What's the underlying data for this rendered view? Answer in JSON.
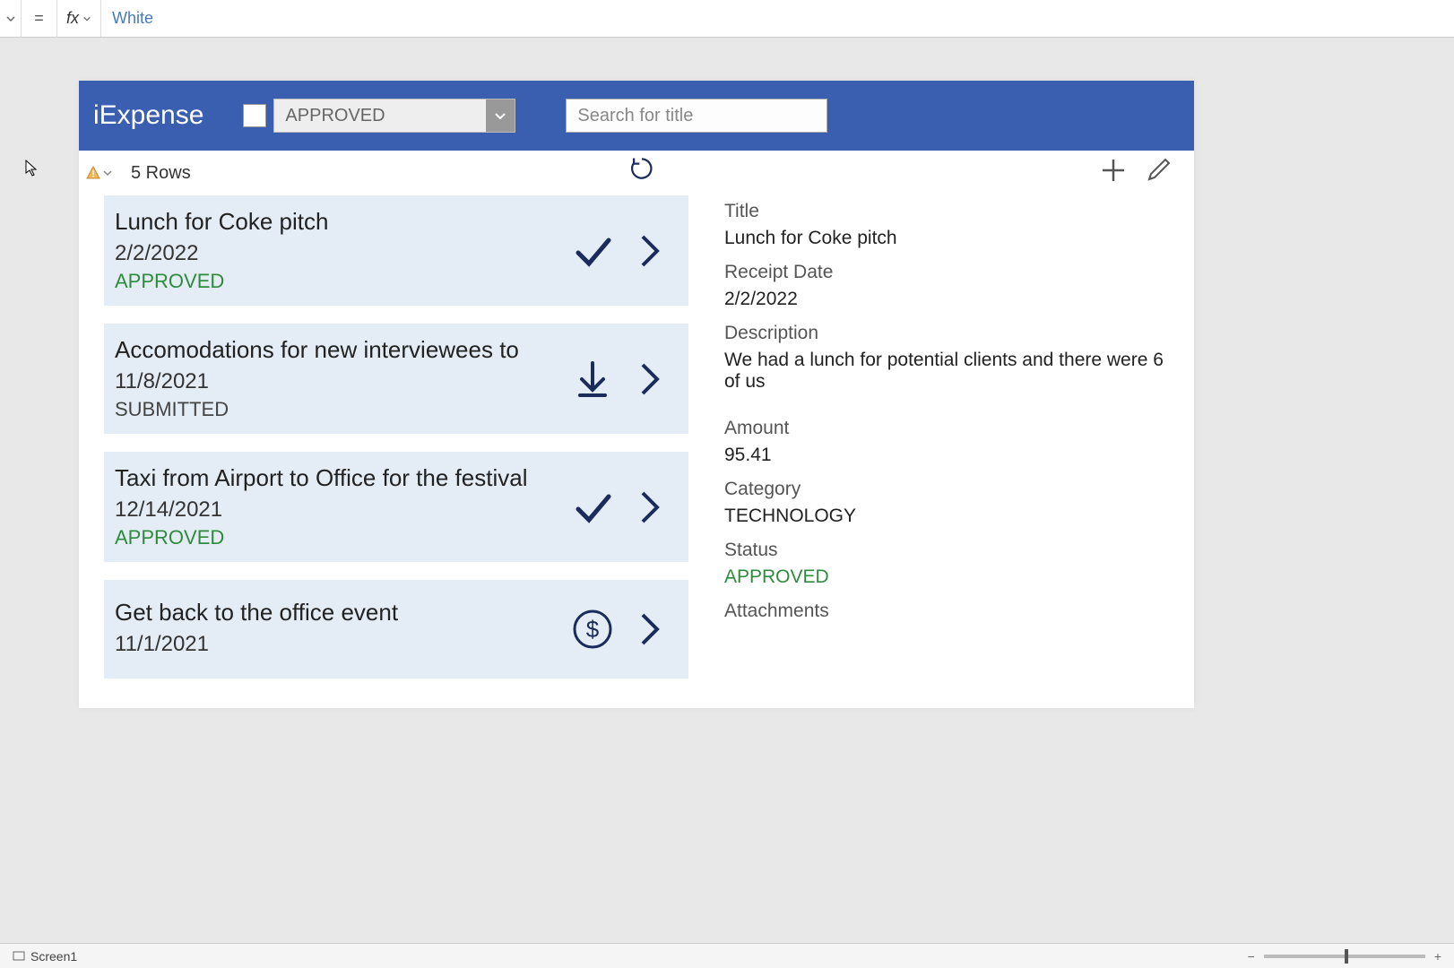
{
  "formula_bar": {
    "equals": "=",
    "fx": "fx",
    "value": "White"
  },
  "app": {
    "title": "iExpense",
    "filter_status": "APPROVED",
    "search_placeholder": "Search for title"
  },
  "list_header": {
    "rows_label": "5 Rows"
  },
  "items": [
    {
      "title": "Lunch for Coke pitch",
      "date": "2/2/2022",
      "status": "APPROVED",
      "status_class": "approved",
      "icon": "check"
    },
    {
      "title": "Accomodations for new interviewees to",
      "date": "11/8/2021",
      "status": "SUBMITTED",
      "status_class": "submitted",
      "icon": "download"
    },
    {
      "title": "Taxi from Airport to Office for the festival",
      "date": "12/14/2021",
      "status": "APPROVED",
      "status_class": "approved",
      "icon": "check"
    },
    {
      "title": "Get back to the office event",
      "date": "11/1/2021",
      "status": "",
      "status_class": "",
      "icon": "dollar"
    }
  ],
  "detail": {
    "fields": {
      "title_label": "Title",
      "title_value": "Lunch for Coke pitch",
      "date_label": "Receipt Date",
      "date_value": "2/2/2022",
      "desc_label": "Description",
      "desc_value": "We had a lunch for potential clients and there were 6 of us",
      "amount_label": "Amount",
      "amount_value": "95.41",
      "category_label": "Category",
      "category_value": "TECHNOLOGY",
      "status_label": "Status",
      "status_value": "APPROVED",
      "attach_label": "Attachments"
    }
  },
  "status_bar": {
    "screen": "Screen1",
    "zoom_minus": "−",
    "zoom_plus": "+"
  }
}
